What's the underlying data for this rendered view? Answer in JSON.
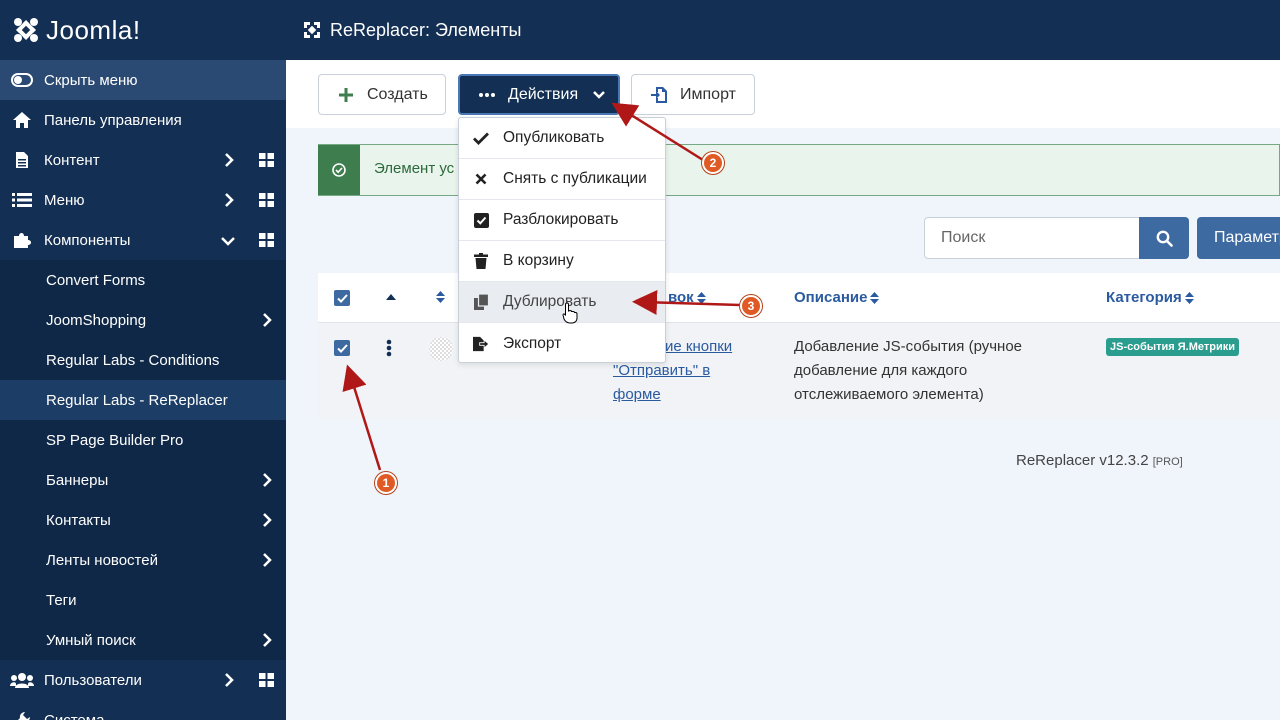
{
  "brand": {
    "name": "Joomla!"
  },
  "header": {
    "title": "ReReplacer: Элементы"
  },
  "sidebar": {
    "hide_menu": "Скрыть меню",
    "items": [
      {
        "label": "Панель управления",
        "icon": "home-icon"
      },
      {
        "label": "Контент",
        "icon": "file-icon"
      },
      {
        "label": "Меню",
        "icon": "list-icon"
      },
      {
        "label": "Компоненты",
        "icon": "puzzle-icon"
      }
    ],
    "components": [
      {
        "label": "Convert Forms"
      },
      {
        "label": "JoomShopping"
      },
      {
        "label": "Regular Labs - Conditions"
      },
      {
        "label": "Regular Labs - ReReplacer"
      },
      {
        "label": "SP Page Builder Pro"
      },
      {
        "label": "Баннеры"
      },
      {
        "label": "Контакты"
      },
      {
        "label": "Ленты новостей"
      },
      {
        "label": "Теги"
      },
      {
        "label": "Умный поиск"
      }
    ],
    "users": "Пользователи",
    "system": "Система"
  },
  "toolbar": {
    "create": "Создать",
    "actions": "Действия",
    "import": "Импорт"
  },
  "actions_menu": [
    {
      "label": "Опубликовать",
      "icon": "check-icon"
    },
    {
      "label": "Снять с публикации",
      "icon": "times-icon"
    },
    {
      "label": "Разблокировать",
      "icon": "checkbox-icon"
    },
    {
      "label": "В корзину",
      "icon": "trash-icon"
    },
    {
      "label": "Дублировать",
      "icon": "copy-icon"
    },
    {
      "label": "Экспорт",
      "icon": "export-icon"
    }
  ],
  "alert": {
    "text": "Элемент ус"
  },
  "search": {
    "placeholder": "Поиск",
    "options_button": "Параметры"
  },
  "table": {
    "columns": {
      "title": "вок",
      "description": "Описание",
      "category": "Категория"
    },
    "rows": [
      {
        "title_line1": "ие кнопки",
        "title_line2": "\"Отправить\" в",
        "title_line3": "форме",
        "description": "Добавление JS-события (ручное добавление для каждого отслеживаемого элемента)",
        "category": "JS-события Я.Метрики"
      }
    ]
  },
  "footer": {
    "version": "ReReplacer v12.3.2",
    "edition": "[PRO]"
  },
  "annotations": [
    {
      "number": "1"
    },
    {
      "number": "2"
    },
    {
      "number": "3"
    }
  ],
  "colors": {
    "sidebar": "#132f53",
    "accent": "#3d6aa0",
    "marker": "#e05a26",
    "arrow": "#b01818"
  }
}
